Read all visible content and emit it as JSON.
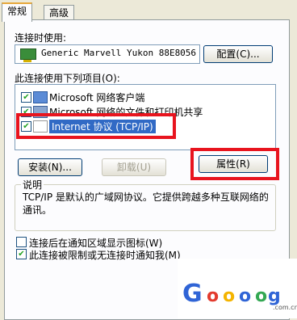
{
  "tabs": [
    {
      "label": "常规"
    },
    {
      "label": "高级"
    }
  ],
  "connect_using": {
    "label": "连接时使用:",
    "device": "Generic Marvell Yukon 88E8056",
    "configure_button": "配置(C)..."
  },
  "items_section": {
    "label": "此连接使用下列项目(O):",
    "items": [
      {
        "label": "Microsoft 网络客户端",
        "checked": true,
        "icon": "network-client-icon"
      },
      {
        "label": "Microsoft 网络的文件和打印机共享",
        "checked": true,
        "icon": "file-share-icon"
      },
      {
        "label": "Internet 协议 (TCP/IP)",
        "checked": true,
        "icon": "protocol-icon",
        "selected": true
      }
    ]
  },
  "buttons": {
    "install": "安装(N)...",
    "uninstall": "卸载(U)",
    "properties": "属性(R)"
  },
  "description": {
    "title": "说明",
    "text": "TCP/IP 是默认的广域网协议。它提供跨越多种互联网络的通讯。"
  },
  "options": [
    {
      "label": "连接后在通知区域显示图标(W)",
      "checked": false
    },
    {
      "label": "此连接被限制或无连接时通知我(M)",
      "checked": true
    }
  ],
  "watermark": {
    "letters": [
      "G",
      "o",
      "o",
      "o",
      "o",
      "g"
    ],
    "colors": [
      "#2f64d6",
      "#e33b2e",
      "#f4b400",
      "#2f64d6",
      "#34a853",
      "#2f64d6"
    ],
    "domain": ".com.cn"
  }
}
